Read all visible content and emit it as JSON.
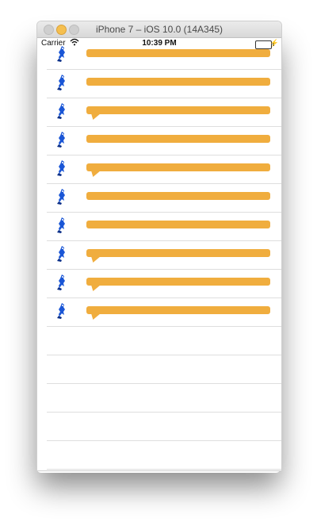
{
  "window": {
    "title": "iPhone 7 – iOS 10.0 (14A345)"
  },
  "statusbar": {
    "carrier": "Carrier",
    "time": "10:39 PM"
  },
  "list": {
    "row_count": 10,
    "empty_rows": 5,
    "icon": "mascot-figure-icon",
    "bar_color": "#f0ad3e",
    "icon_color": "#1a56d6"
  }
}
